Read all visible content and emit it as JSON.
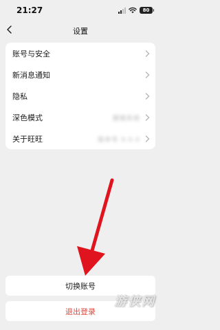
{
  "status_bar": {
    "time": "21:27",
    "battery": "80"
  },
  "nav": {
    "title": "设置"
  },
  "menu": {
    "items": [
      {
        "label": "账号与安全",
        "value": ""
      },
      {
        "label": "新消息通知",
        "value": ""
      },
      {
        "label": "隐私",
        "value": ""
      },
      {
        "label": "深色模式",
        "value": "跟随系统"
      },
      {
        "label": "关于旺旺",
        "value": "版本号 9.0.0"
      }
    ]
  },
  "actions": {
    "switch_account": "切换账号",
    "logout": "退出登录"
  },
  "colors": {
    "logout": "#e0463a",
    "arrow": "#e0141e",
    "background": "#efefef"
  },
  "watermark": "游侠网"
}
